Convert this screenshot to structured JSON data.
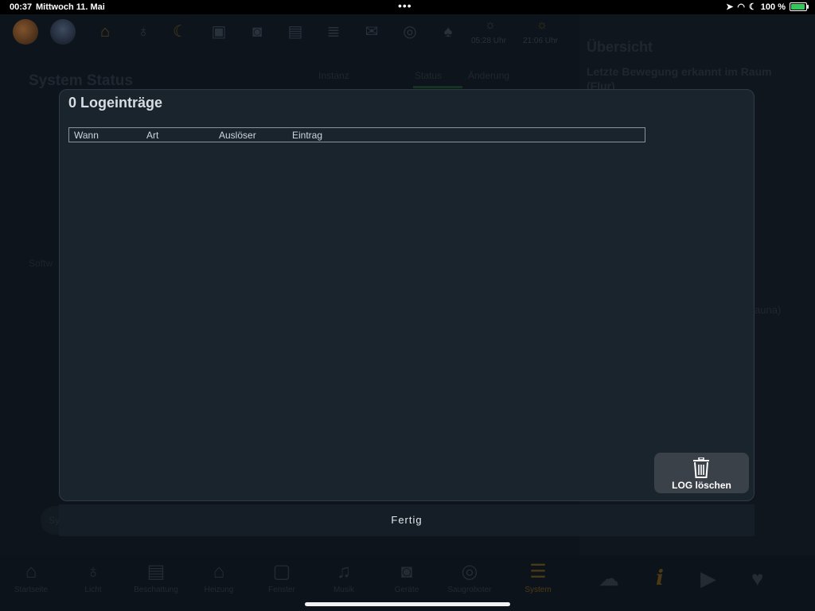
{
  "status_bar": {
    "time": "00:37",
    "date": "Mittwoch 11. Mai",
    "battery": "100 %"
  },
  "top_nav": {
    "icons": [
      "home-icon",
      "light-bulb-icon",
      "moon-icon",
      "lock-icon",
      "washer-icon",
      "blinds-icon",
      "radiator-icon",
      "mailbox-icon",
      "vacuum-icon",
      "bell-icon"
    ],
    "sunrise": "05:28 Uhr",
    "sunset": "21:06 Uhr"
  },
  "background": {
    "title": "System Status",
    "tabs": [
      "Instanz",
      "Status",
      "Änderung"
    ],
    "section_label": "Softw",
    "side_title": "Übersicht",
    "side_subtitle": "Letzte Bewegung erkannt im Raum (Flur)",
    "side_fragment": "auna)",
    "pill_label": "Sy"
  },
  "modal": {
    "title": "0 Logeinträge",
    "columns": [
      "Wann",
      "Art",
      "Auslöser",
      "Eintrag"
    ],
    "rows": [],
    "clear_button_label": "LOG löschen",
    "done_label": "Fertig"
  },
  "bottom_tabs": [
    {
      "label": "Startseite",
      "icon": "home-icon"
    },
    {
      "label": "Licht",
      "icon": "light-bulb-icon"
    },
    {
      "label": "Beschattung",
      "icon": "blinds-icon"
    },
    {
      "label": "Heizung",
      "icon": "heating-icon"
    },
    {
      "label": "Fenster",
      "icon": "window-icon"
    },
    {
      "label": "Musik",
      "icon": "music-icon"
    },
    {
      "label": "Geräte",
      "icon": "washer-icon"
    },
    {
      "label": "Saugroboter",
      "icon": "vacuum-icon"
    },
    {
      "label": "System",
      "icon": "server-icon",
      "active": true
    }
  ],
  "right_tabs": [
    "weather-icon",
    "info-icon",
    "play-icon",
    "heartbeat-icon"
  ],
  "colors": {
    "accent": "#f5b21a",
    "modal_bg": "#1a242d",
    "button_bg": "#3a4149"
  }
}
